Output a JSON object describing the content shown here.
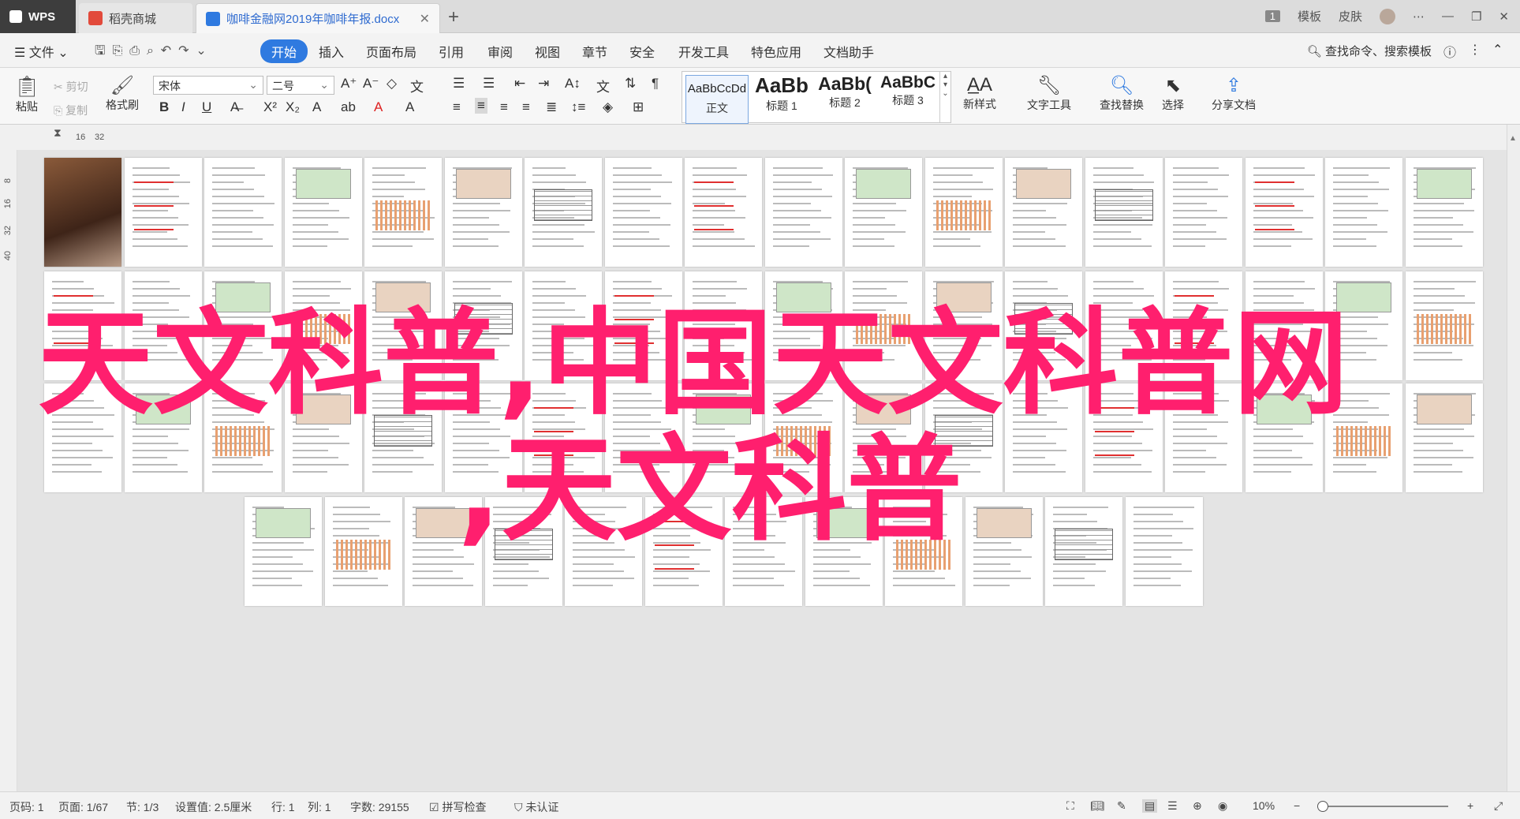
{
  "tabs": {
    "wps": "WPS",
    "store": "稻壳商城",
    "document": "咖啡金融网2019年咖啡年报.docx",
    "close": "✕",
    "new": "+"
  },
  "topright": {
    "count": "1",
    "template": "模板",
    "skin": "皮肤"
  },
  "menu": {
    "file": "文件",
    "items": [
      "开始",
      "插入",
      "页面布局",
      "引用",
      "审阅",
      "视图",
      "章节",
      "安全",
      "开发工具",
      "特色应用",
      "文档助手"
    ],
    "search": "查找命令、搜索模板"
  },
  "ribbon": {
    "paste": "粘贴",
    "cut": "剪切",
    "copy": "复制",
    "format_painter": "格式刷",
    "font_name": "宋体",
    "font_size": "二号",
    "styles": [
      {
        "sample": "AaBbCcDd",
        "name": "正文"
      },
      {
        "sample": "AaBb",
        "name": "标题 1"
      },
      {
        "sample": "AaBb(",
        "name": "标题 2"
      },
      {
        "sample": "AaBbC",
        "name": "标题 3"
      }
    ],
    "new_style": "新样式",
    "text_tools": "文字工具",
    "find_replace": "查找替换",
    "select": "选择",
    "share": "分享文档"
  },
  "ruler": {
    "marks": [
      "16",
      "32"
    ],
    "vmarks": [
      "8",
      "16",
      "32",
      "40"
    ]
  },
  "overlay": {
    "line1": "天文科普,中国天文科普网",
    "line2": ",天文科普"
  },
  "status": {
    "pages": "页码: 1",
    "page_of": "页面: 1/67",
    "section": "节: 1/3",
    "position": "设置值: 2.5厘米",
    "row": "行: 1",
    "col": "列: 1",
    "words": "字数: 29155",
    "spell": "拼写检查",
    "cert": "未认证",
    "zoom": "10%"
  },
  "colors": {
    "accent": "#2f7ae0",
    "overlay": "#ff1f6e"
  }
}
